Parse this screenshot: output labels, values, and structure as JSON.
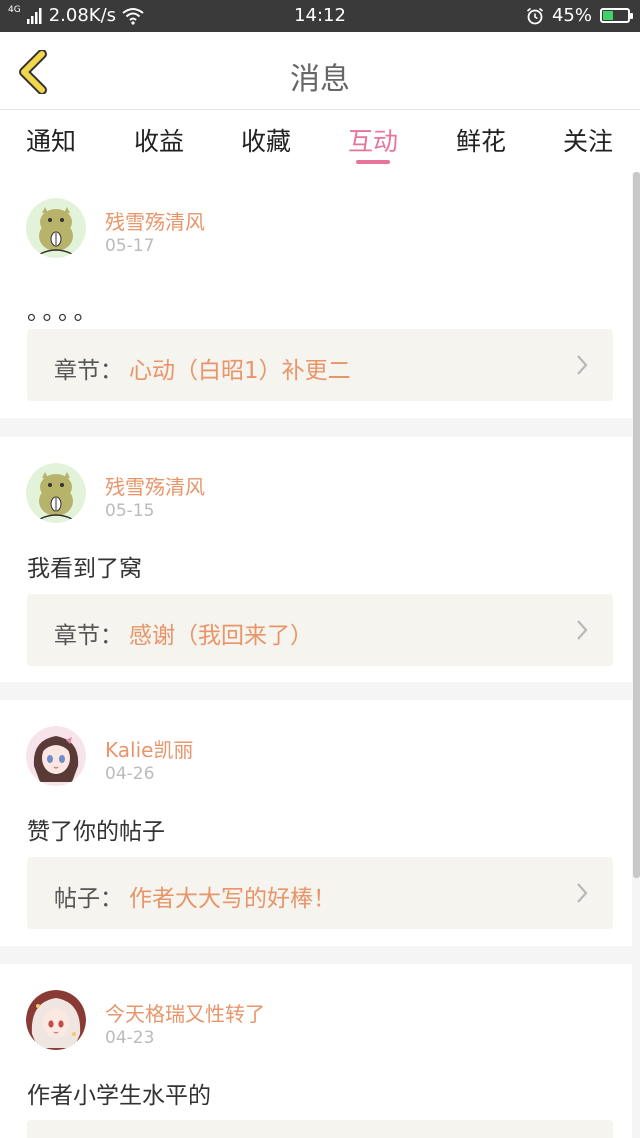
{
  "status_bar": {
    "network": "4G",
    "speed": "2.08K/s",
    "time": "14:12",
    "battery_percent": "45%",
    "battery_level": 0.45
  },
  "header": {
    "title": "消息"
  },
  "tabs": [
    {
      "label": "通知",
      "active": false
    },
    {
      "label": "收益",
      "active": false
    },
    {
      "label": "收藏",
      "active": false
    },
    {
      "label": "互动",
      "active": true
    },
    {
      "label": "鲜花",
      "active": false
    },
    {
      "label": "关注",
      "active": false
    }
  ],
  "messages": [
    {
      "username": "残雪殇清风",
      "date": "05-17",
      "text": "。。。。",
      "ref_label": "章节：",
      "ref_value": "心动（白昭1）补更二"
    },
    {
      "username": "残雪殇清风",
      "date": "05-15",
      "text": "我看到了窝",
      "ref_label": "章节：",
      "ref_value": "感谢（我回来了）"
    },
    {
      "username": "Kalie凯丽",
      "date": "04-26",
      "text": "赞了你的帖子",
      "ref_label": "帖子：",
      "ref_value": "作者大大写的好棒！"
    },
    {
      "username": "今天格瑞又性转了",
      "date": "04-23",
      "text": "作者小学生水平的"
    }
  ],
  "colors": {
    "accent_pink": "#e8749b",
    "username_orange": "#e8956a",
    "back_icon_yellow": "#f2d64b"
  }
}
